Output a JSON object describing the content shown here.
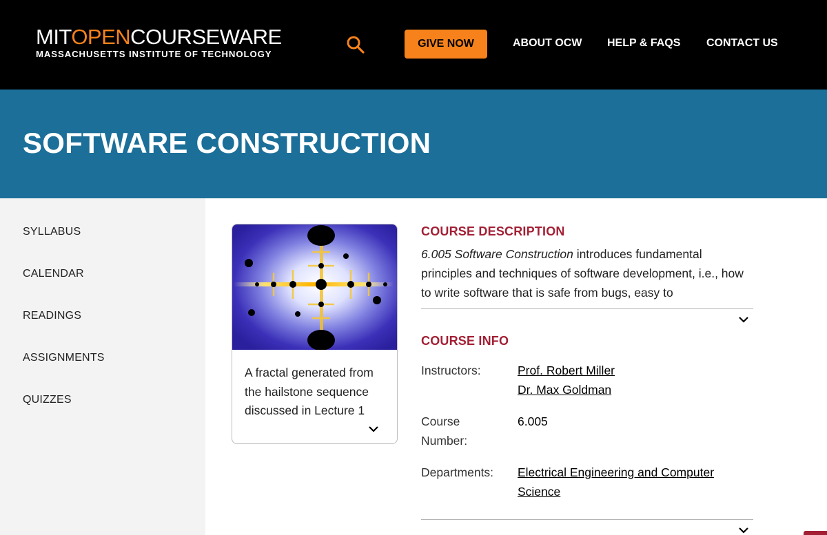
{
  "header": {
    "logo": {
      "main_white_1": "MIT",
      "main_orange": "OPEN",
      "main_white_2": "COURSEWARE",
      "subtitle": "MASSACHUSETTS INSTITUTE OF TECHNOLOGY"
    },
    "search_icon": "search-icon",
    "give_now_label": "GIVE NOW",
    "nav": {
      "about": "ABOUT OCW",
      "help": "HELP & FAQS",
      "contact": "CONTACT US"
    }
  },
  "banner": {
    "title": "SOFTWARE CONSTRUCTION"
  },
  "sidebar": {
    "items": [
      {
        "label": "SYLLABUS"
      },
      {
        "label": "CALENDAR"
      },
      {
        "label": "READINGS"
      },
      {
        "label": "ASSIGNMENTS"
      },
      {
        "label": "QUIZZES"
      }
    ]
  },
  "image_card": {
    "caption": "A fractal generated from the hailstone sequence discussed in Lecture 1",
    "expand_icon": "chevron-down-icon"
  },
  "course_description": {
    "heading": "COURSE DESCRIPTION",
    "course_name": "6.005 Software Construction",
    "text": " introduces fundamental principles and techniques of software development, i.e., how to write software that is safe from bugs, easy to",
    "expand_icon": "chevron-down-icon"
  },
  "course_info": {
    "heading": "COURSE INFO",
    "instructors_label": "Instructors:",
    "instructors": [
      "Prof. Robert Miller",
      "Dr. Max Goldman"
    ],
    "course_number_label": "Course Number:",
    "course_number": "6.005",
    "departments_label": "Departments:",
    "department": "Electrical Engineering and Computer Science",
    "expand_icon": "chevron-down-icon"
  },
  "colors": {
    "header_bg": "#000000",
    "accent_orange": "#f7821b",
    "banner_blue": "#1b6f99",
    "heading_red": "#a31f34",
    "sidebar_bg": "#f3f3f3"
  }
}
